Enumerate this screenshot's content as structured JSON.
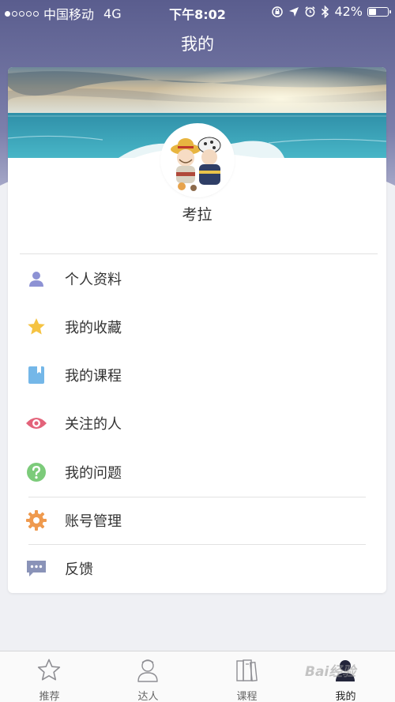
{
  "status_bar": {
    "carrier": "中国移动",
    "network": "4G",
    "time": "下午8:02",
    "battery": "42%",
    "battery_level": 0.42
  },
  "nav": {
    "title": "我的"
  },
  "profile": {
    "username": "考拉"
  },
  "menu": [
    {
      "label": "个人资料",
      "icon": "person-icon",
      "color": "#8d92d4"
    },
    {
      "label": "我的收藏",
      "icon": "star-icon",
      "color": "#f5c342"
    },
    {
      "label": "我的课程",
      "icon": "bookmark-icon",
      "color": "#74b7e8"
    },
    {
      "label": "关注的人",
      "icon": "eye-icon",
      "color": "#e3637a"
    },
    {
      "label": "我的问题",
      "icon": "question-icon",
      "color": "#7ccb7a"
    },
    {
      "label": "账号管理",
      "icon": "gear-icon",
      "color": "#ef9a4e"
    },
    {
      "label": "反馈",
      "icon": "chat-bubble-icon",
      "color": "#8a93b8"
    }
  ],
  "tab_bar": {
    "tabs": [
      {
        "label": "推荐",
        "icon": "star-outline-icon"
      },
      {
        "label": "达人",
        "icon": "person-outline-icon"
      },
      {
        "label": "课程",
        "icon": "books-icon"
      },
      {
        "label": "我的",
        "icon": "person-filled-icon",
        "active": true
      }
    ]
  },
  "watermark": "Bai经验"
}
